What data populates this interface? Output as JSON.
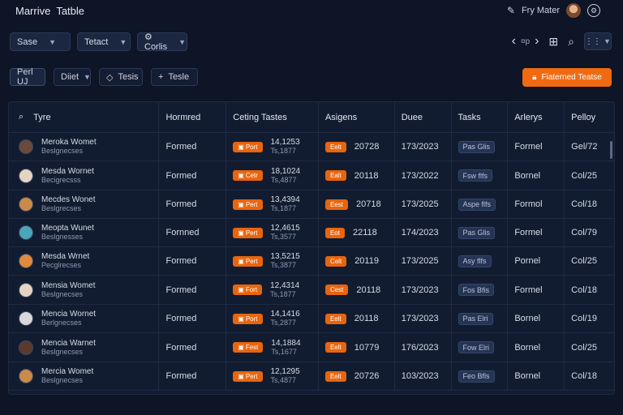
{
  "header": {
    "app_title": "Marrive  Tatble",
    "user_name": "Fry Mater"
  },
  "filters": [
    {
      "label": "Sase"
    },
    {
      "label": "Tetact"
    },
    {
      "label": "⚙ Corlis"
    }
  ],
  "toolbar": {
    "pager_label": "¤p",
    "grid_label": "⋮⋮"
  },
  "actions": {
    "chips": [
      {
        "label": "Perl UJ"
      },
      {
        "label": "Diiet"
      },
      {
        "label": "Tesis"
      },
      {
        "label": "Tesle"
      }
    ],
    "primary_label": "Fiaterned Teatse"
  },
  "table": {
    "columns": [
      "Tyre",
      "Hormred",
      "Ceting Tastes",
      "Asigens",
      "Duee",
      "Tasks",
      "Arlerys",
      "Pelloy"
    ],
    "rows": [
      {
        "name": "Meroka Womet",
        "sub": "Beslgnecses",
        "status": "Formed",
        "tag": "Port",
        "v1": "14,1253",
        "v2": "Ts,1877",
        "atag": "Eelt",
        "anum": "20728",
        "due": "173/2023",
        "task": "Pas Glis",
        "agency": "Formel",
        "policy": "Gel/72",
        "avatar": "#6a4a3a"
      },
      {
        "name": "Mesda Wornet",
        "sub": "Becigrecsss",
        "status": "Formed",
        "tag": "Cetr",
        "v1": "18,1024",
        "v2": "Ts,4877",
        "atag": "Ealt",
        "anum": "20118",
        "due": "173/2022",
        "task": "Fsw flfs",
        "agency": "Bornel",
        "policy": "Col/25",
        "avatar": "#e6d4c2"
      },
      {
        "name": "Mecdes Wonet",
        "sub": "Beslgrecses",
        "status": "Formed",
        "tag": "Pert",
        "v1": "13,4394",
        "v2": "Ts,1877",
        "atag": "Eest",
        "anum": "20718",
        "due": "173/2025",
        "task": "Aspe flfs",
        "agency": "Formol",
        "policy": "Col/18",
        "avatar": "#c98a4a"
      },
      {
        "name": "Meopta Wunet",
        "sub": "Beslgnesses",
        "status": "Fornned",
        "tag": "Pert",
        "v1": "12,4615",
        "v2": "Ts,3577",
        "atag": "Eot",
        "anum": "22118",
        "due": "174/2023",
        "task": "Pas Glis",
        "agency": "Formel",
        "policy": "Col/79",
        "avatar": "#4aa6b8"
      },
      {
        "name": "Mesda Wrnet",
        "sub": "Pecglrecses",
        "status": "Formed",
        "tag": "Pert",
        "v1": "13,5215",
        "v2": "Ts,3877",
        "atag": "Celt",
        "anum": "20119",
        "due": "173/2025",
        "task": "Asy flfs",
        "agency": "Pornel",
        "policy": "Col/25",
        "avatar": "#e08a3c"
      },
      {
        "name": "Mensia Womet",
        "sub": "Beslgnecses",
        "status": "Formed",
        "tag": "Fort",
        "v1": "12,4314",
        "v2": "Ts,1877",
        "atag": "Cest",
        "anum": "20118",
        "due": "173/2023",
        "task": "Fos Bfis",
        "agency": "Formel",
        "policy": "Col/18",
        "avatar": "#e6d4c2"
      },
      {
        "name": "Mencia Wornet",
        "sub": "Berlgnecses",
        "status": "Formed",
        "tag": "Port",
        "v1": "14,1416",
        "v2": "Ts,2877",
        "atag": "Eelt",
        "anum": "20118",
        "due": "173/2023",
        "task": "Pas Elri",
        "agency": "Bornel",
        "policy": "Col/19",
        "avatar": "#d9d9d9"
      },
      {
        "name": "Mencia Warnet",
        "sub": "Beslgnecses",
        "status": "Formed",
        "tag": "Fest",
        "v1": "14,1884",
        "v2": "Ts,1677",
        "atag": "Eelt",
        "anum": "10779",
        "due": "176/2023",
        "task": "Fow Elri",
        "agency": "Bornel",
        "policy": "Col/25",
        "avatar": "#5a3a2a"
      },
      {
        "name": "Mercia Womet",
        "sub": "Beslgnecses",
        "status": "Formed",
        "tag": "Pert",
        "v1": "12,1295",
        "v2": "Ts,4877",
        "atag": "Eelt",
        "anum": "20726",
        "due": "103/2023",
        "task": "Feo Bfls",
        "agency": "Bornel",
        "policy": "Col/18",
        "avatar": "#c98a4a"
      }
    ]
  }
}
